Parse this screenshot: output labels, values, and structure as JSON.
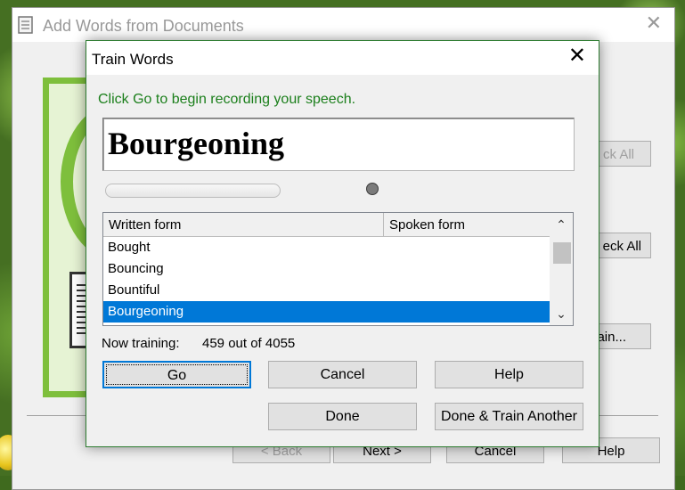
{
  "parent_window": {
    "title": "Add Words from Documents",
    "close_glyph": "✕",
    "buttons": {
      "check_all_partial": "ck All",
      "uncheck_all_partial": "eck All",
      "train_partial": "ain...",
      "back": "< Back",
      "next": "Next >",
      "cancel": "Cancel",
      "help": "Help"
    }
  },
  "dialog": {
    "title": "Train Words",
    "close_glyph": "✕",
    "instruction": "Click Go to begin recording your speech.",
    "current_word": "Bourgeoning",
    "list": {
      "columns": [
        "Written form",
        "Spoken form"
      ],
      "rows": [
        {
          "written": "Bought",
          "spoken": ""
        },
        {
          "written": "Bouncing",
          "spoken": ""
        },
        {
          "written": "Bountiful",
          "spoken": ""
        },
        {
          "written": "Bourgeoning",
          "spoken": ""
        }
      ],
      "selected_index": 3,
      "scroll_up_glyph": "⌃",
      "scroll_down_glyph": "⌄"
    },
    "status": {
      "label": "Now training:",
      "value": "459 out of 4055"
    },
    "buttons": {
      "go": "Go",
      "cancel": "Cancel",
      "help": "Help",
      "done": "Done",
      "done_train_another": "Done & Train Another"
    }
  },
  "colors": {
    "accent": "#0078d7",
    "instruction_text": "#1b7f1b",
    "logo_green": "#7ebf3c"
  }
}
